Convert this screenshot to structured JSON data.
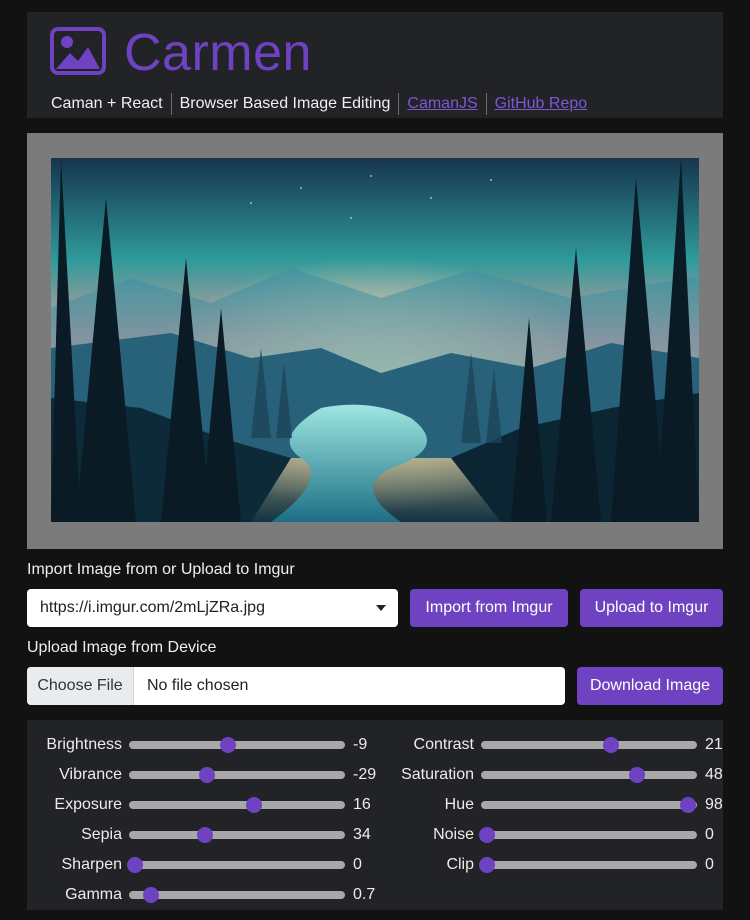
{
  "header": {
    "title": "Carmen",
    "nav": [
      {
        "label": "Caman + React",
        "link": false
      },
      {
        "label": "Browser Based Image Editing",
        "link": false
      },
      {
        "label": "CamanJS",
        "link": true
      },
      {
        "label": "GitHub Repo",
        "link": true
      }
    ]
  },
  "colors": {
    "accent": "#6f42c1",
    "panel": "#222327",
    "background": "#121212",
    "canvas_bg": "#7b7b7b"
  },
  "import_section": {
    "label": "Import Image from or Upload to Imgur",
    "url_value": "https://i.imgur.com/2mLjZRa.jpg",
    "import_button": "Import from Imgur",
    "upload_button": "Upload to Imgur"
  },
  "device_section": {
    "label": "Upload Image from Device",
    "choose_button": "Choose File",
    "file_status": "No file chosen",
    "download_button": "Download Image"
  },
  "sliders": {
    "left": [
      {
        "label": "Brightness",
        "value": "-9",
        "fraction": 0.46
      },
      {
        "label": "Vibrance",
        "value": "-29",
        "fraction": 0.36
      },
      {
        "label": "Exposure",
        "value": "16",
        "fraction": 0.58
      },
      {
        "label": "Sepia",
        "value": "34",
        "fraction": 0.35
      },
      {
        "label": "Sharpen",
        "value": "0",
        "fraction": 0.03
      },
      {
        "label": "Gamma",
        "value": "0.7",
        "fraction": 0.1
      }
    ],
    "right": [
      {
        "label": "Contrast",
        "value": "21",
        "fraction": 0.6
      },
      {
        "label": "Saturation",
        "value": "48",
        "fraction": 0.72
      },
      {
        "label": "Hue",
        "value": "98",
        "fraction": 0.96
      },
      {
        "label": "Noise",
        "value": "0",
        "fraction": 0.03
      },
      {
        "label": "Clip",
        "value": "0",
        "fraction": 0.03
      }
    ]
  }
}
